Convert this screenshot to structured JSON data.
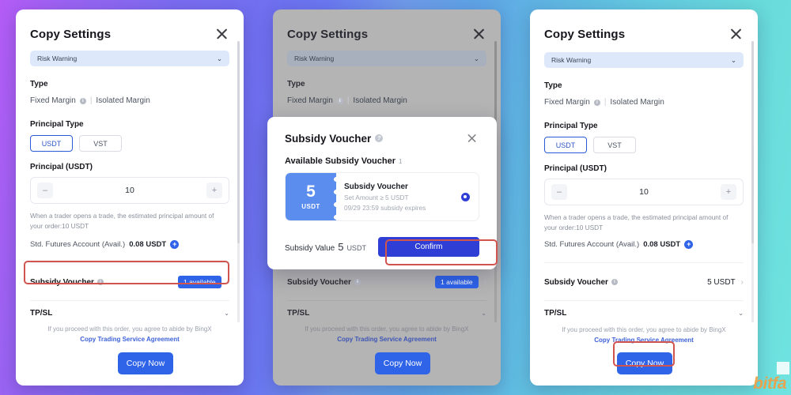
{
  "background": {
    "from": "#b45cf5",
    "mid": "#6a78f0",
    "to": "#6fe3e0"
  },
  "accent": {
    "blue": "#2f63e8",
    "deep_blue": "#2f3fd6",
    "ticket": "#5b8def",
    "red_box": "#d2544e",
    "watermark": "#f0a044"
  },
  "watermark": {
    "text": "bitfa"
  },
  "common": {
    "title": "Copy Settings",
    "close_icon": "close-icon",
    "risk_banner": {
      "text": "Risk Warning",
      "chevron": "chevron-down-icon"
    },
    "type": {
      "label": "Type",
      "fixed_margin": "Fixed Margin",
      "fixed_margin_info_icon": "info-icon",
      "divider": "|",
      "isolated_margin": "Isolated Margin"
    },
    "principal_type": {
      "label": "Principal Type",
      "options": [
        "USDT",
        "VST"
      ],
      "selected": "USDT"
    },
    "principal": {
      "label": "Principal (USDT)",
      "value": "10",
      "minus": "–",
      "plus": "+",
      "note": "When a trader opens a trade, the estimated principal amount of your order:10 USDT",
      "account_label": "Std. Futures Account (Avail.)",
      "account_value": "0.08 USDT",
      "add_icon": "plus-circle-icon"
    },
    "subsidy_row": {
      "label": "Subsidy Voucher",
      "info_icon": "info-icon",
      "chevron": "chevron-right-icon"
    },
    "tpsl": {
      "label": "TP/SL",
      "chevron": "chevron-down-icon"
    },
    "footer": {
      "agree_prefix": "If you proceed with this order, you agree to abide by BingX ",
      "agree_link": "Copy Trading Service Agreement",
      "cta": "Copy Now"
    }
  },
  "panels": [
    {
      "id": "panel-1",
      "subsidy_value": "1 available",
      "subsidy_is_pill": true
    },
    {
      "id": "panel-2",
      "subsidy_value": "1 available",
      "subsidy_is_pill": true
    },
    {
      "id": "panel-3",
      "subsidy_value": "5 USDT",
      "subsidy_is_pill": false
    }
  ],
  "modal": {
    "title": "Subsidy Voucher",
    "title_info_icon": "help-icon",
    "close_icon": "close-icon",
    "available_label": "Available Subsidy Voucher",
    "available_count": "1",
    "voucher": {
      "amount": "5",
      "currency": "USDT",
      "name": "Subsidy Voucher",
      "condition": "Set Amount ≥ 5 USDT",
      "expiry": "09/29 23:59 subsidy expires",
      "selected": true,
      "radio_icon": "radio-selected-icon"
    },
    "footer": {
      "value_label": "Subsidy Value",
      "value_amount": "5",
      "value_currency": "USDT",
      "confirm": "Confirm"
    }
  }
}
